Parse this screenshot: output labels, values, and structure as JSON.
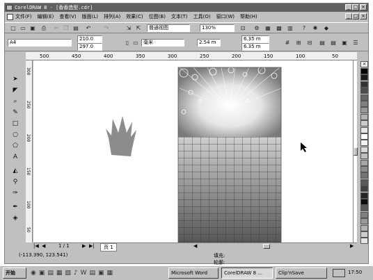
{
  "window": {
    "title": "CorelDRAW 8 - [香香造型.cdr]",
    "controls": [
      "_",
      "□",
      "×"
    ]
  },
  "menu": [
    "文件(F)",
    "编辑(E)",
    "查看(V)",
    "版面(L)",
    "排列(A)",
    "效果(C)",
    "位图(B)",
    "文本(T)",
    "工具(O)",
    "窗口(W)",
    "帮助(H)"
  ],
  "toolbar": {
    "view_mode": "普通视图",
    "zoom": "130%"
  },
  "propbar": {
    "paper_size": "A4",
    "width": "210.0",
    "height": "297.0",
    "units": "毫米",
    "nudge": "2.54 m",
    "dup_x": "6.35 m",
    "dup_y": "6.35 m"
  },
  "ruler_h": [
    "500",
    "450",
    "400",
    "350",
    "300",
    "250",
    "200",
    "150",
    "100",
    "50"
  ],
  "ruler_v": [
    "300",
    "250",
    "200",
    "150",
    "100",
    "50"
  ],
  "page_nav": {
    "counter": "1 / 1",
    "page_tab": "页 1"
  },
  "status": {
    "coords": "(-113.390, 123.541)",
    "fill_label": "填充:",
    "outline_label": "轮廓:"
  },
  "taskbar": {
    "start": "开始",
    "tasks": [
      "Microsoft Word",
      "CorelDRAW 8 ...",
      "Clip'nSave"
    ],
    "clock": "17:50"
  },
  "palette_colors": [
    "#000000",
    "#1a1a1a",
    "#333333",
    "#4d4d4d",
    "#666666",
    "#808080",
    "#999999",
    "#b3b3b3",
    "#cccccc",
    "#e6e6e6",
    "#ffffff",
    "#f2f2f2",
    "#d9d9d9",
    "#bfbfbf",
    "#a6a6a6",
    "#8c8c8c",
    "#737373",
    "#595959",
    "#404040",
    "#262626",
    "#0d0d0d",
    "#595959",
    "#7f7f7f",
    "#999999",
    "#b2b2b2",
    "#cccccc",
    "#e5e5e5"
  ]
}
